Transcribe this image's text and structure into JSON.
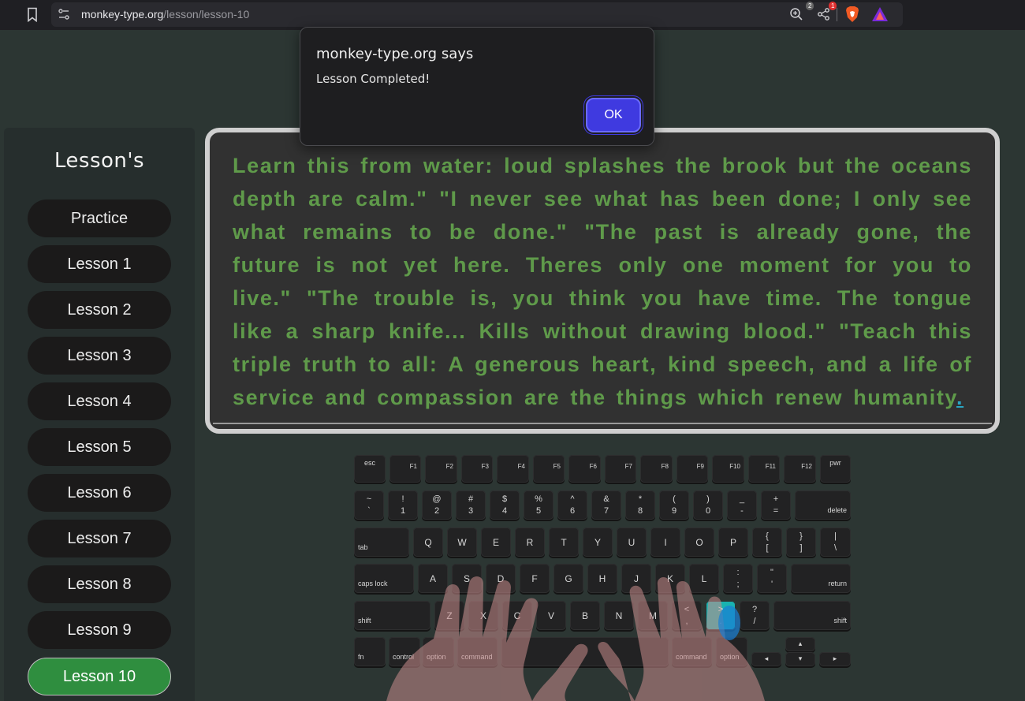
{
  "browser": {
    "url_host": "monkey-type.org",
    "url_path": "/lesson/lesson-10",
    "brave_badge": "2",
    "rewards_badge": "1"
  },
  "alert": {
    "title": "monkey-type.org says",
    "message": "Lesson Completed!",
    "ok_label": "OK"
  },
  "sidebar": {
    "title": "Lesson's",
    "items": [
      {
        "label": "Practice"
      },
      {
        "label": "Lesson 1"
      },
      {
        "label": "Lesson 2"
      },
      {
        "label": "Lesson 3"
      },
      {
        "label": "Lesson 4"
      },
      {
        "label": "Lesson 5"
      },
      {
        "label": "Lesson 6"
      },
      {
        "label": "Lesson 7"
      },
      {
        "label": "Lesson 8"
      },
      {
        "label": "Lesson 9"
      },
      {
        "label": "Lesson 10"
      }
    ],
    "active_index": 10
  },
  "lesson": {
    "text": "Learn this from water: loud splashes the brook but the oceans depth are calm.\" \"I never see what has been done; I only see what remains to be done.\" \"The past is already gone, the future is not yet here. Theres only one moment for you to live.\" \"The trouble is, you think you have time. The tongue like a sharp knife... Kills without drawing blood.\" \"Teach this triple truth to all: A generous heart, kind speech, and a life of service and compassion are the things which renew humanity",
    "cursor_char": "."
  },
  "keyboard": {
    "fn_row": [
      "esc",
      "F1",
      "F2",
      "F3",
      "F4",
      "F5",
      "F6",
      "F7",
      "F8",
      "F9",
      "F10",
      "F11",
      "F12",
      "pwr"
    ],
    "num_row": [
      {
        "top": "~",
        "bot": "`"
      },
      {
        "top": "!",
        "bot": "1"
      },
      {
        "top": "@",
        "bot": "2"
      },
      {
        "top": "#",
        "bot": "3"
      },
      {
        "top": "$",
        "bot": "4"
      },
      {
        "top": "%",
        "bot": "5"
      },
      {
        "top": "^",
        "bot": "6"
      },
      {
        "top": "&",
        "bot": "7"
      },
      {
        "top": "*",
        "bot": "8"
      },
      {
        "top": "(",
        "bot": "9"
      },
      {
        "top": ")",
        "bot": "0"
      },
      {
        "top": "_",
        "bot": "-"
      },
      {
        "top": "+",
        "bot": "="
      }
    ],
    "delete_label": "delete",
    "tab_label": "tab",
    "q_row": [
      "Q",
      "W",
      "E",
      "R",
      "T",
      "Y",
      "U",
      "I",
      "O",
      "P"
    ],
    "q_row_sym": [
      {
        "top": "{",
        "bot": "["
      },
      {
        "top": "}",
        "bot": "]"
      },
      {
        "top": "|",
        "bot": "\\"
      }
    ],
    "caps_label": "caps lock",
    "a_row": [
      "A",
      "S",
      "D",
      "F",
      "G",
      "H",
      "J",
      "K",
      "L"
    ],
    "a_row_sym": [
      {
        "top": ":",
        "bot": ";"
      },
      {
        "top": "\"",
        "bot": "'"
      }
    ],
    "return_label": "return",
    "shift_label": "shift",
    "z_row": [
      "Z",
      "X",
      "C",
      "V",
      "B",
      "N",
      "M"
    ],
    "z_row_sym": [
      {
        "top": "<",
        "bot": ","
      },
      {
        "top": ">",
        "bot": "."
      },
      {
        "top": "?",
        "bot": "/"
      }
    ],
    "bottom": {
      "fn": "fn",
      "control": "control",
      "option": "option",
      "command": "command"
    },
    "arrows": {
      "left": "◂",
      "up": "▴",
      "down": "▾",
      "right": "▸"
    },
    "highlight_key": ">",
    "highlight_color": "#19b3b0"
  },
  "colors": {
    "background": "#2c3633",
    "text_green": "#5f9a4a",
    "active_lesson": "#2f8e3f",
    "ok_button": "#3f3ae0"
  }
}
